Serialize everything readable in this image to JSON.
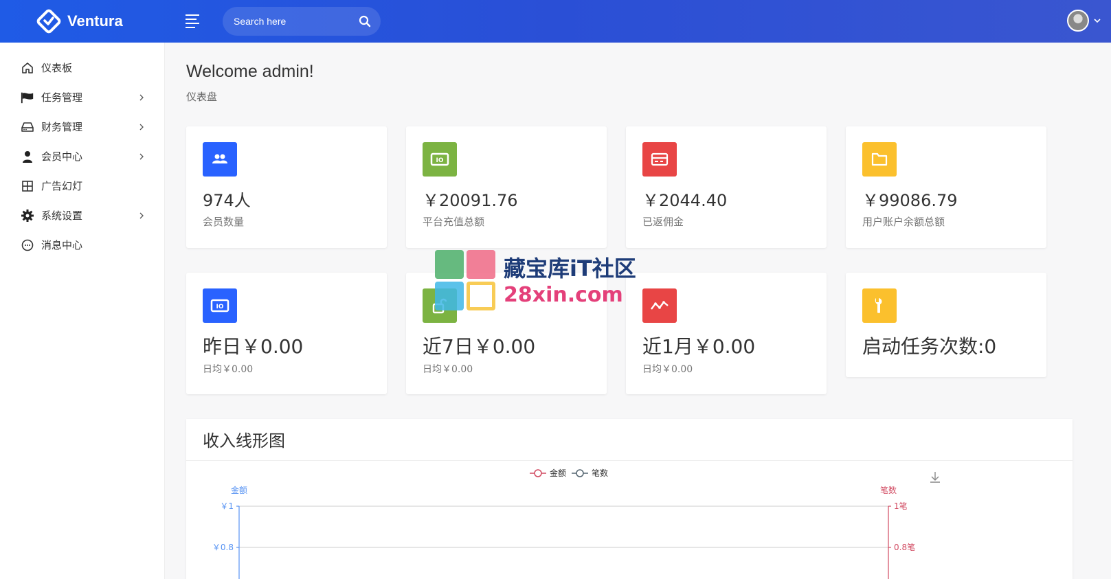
{
  "header": {
    "brand": "Ventura",
    "search_placeholder": "Search here"
  },
  "sidebar": {
    "items": [
      {
        "label": "仪表板",
        "icon": "home-icon",
        "has_children": false
      },
      {
        "label": "任务管理",
        "icon": "flag-icon",
        "has_children": true
      },
      {
        "label": "财务管理",
        "icon": "drive-icon",
        "has_children": true
      },
      {
        "label": "会员中心",
        "icon": "user-icon",
        "has_children": true
      },
      {
        "label": "广告幻灯",
        "icon": "grid-icon",
        "has_children": false
      },
      {
        "label": "系统设置",
        "icon": "gear-icon",
        "has_children": true
      },
      {
        "label": "消息中心",
        "icon": "chat-icon",
        "has_children": false
      }
    ]
  },
  "page": {
    "title": "Welcome admin!",
    "breadcrumb": "仪表盘"
  },
  "stats": [
    {
      "value": "974人",
      "label": "会员数量",
      "color": "#2962ff",
      "icon": "users-icon"
    },
    {
      "value": "￥20091.76",
      "label": "平台充值总额",
      "color": "#7cb342",
      "icon": "money-icon"
    },
    {
      "value": "￥2044.40",
      "label": "已返佣金",
      "color": "#e84545",
      "icon": "card-icon"
    },
    {
      "value": "￥99086.79",
      "label": "用户账户余额总额",
      "color": "#fbc02d",
      "icon": "folder-icon"
    }
  ],
  "periods": [
    {
      "value": "昨日￥0.00",
      "sub": "日均￥0.00",
      "color": "#2962ff",
      "icon": "money-icon"
    },
    {
      "value": "近7日￥0.00",
      "sub": "日均￥0.00",
      "color": "#7cb342",
      "icon": "unlock-icon"
    },
    {
      "value": "近1月￥0.00",
      "sub": "日均￥0.00",
      "color": "#e84545",
      "icon": "trend-icon"
    },
    {
      "value": "启动任务次数:0",
      "sub": "",
      "color": "#fbc02d",
      "icon": "wrench-icon"
    }
  ],
  "chart_data": {
    "type": "line",
    "title": "收入线形图",
    "series": [
      {
        "name": "金额",
        "color": "#d14a61",
        "values": []
      },
      {
        "name": "笔数",
        "color": "#546570",
        "values": []
      }
    ],
    "y_left": {
      "name": "金额",
      "ticks": [
        "￥1",
        "￥0.8"
      ],
      "color": "#5793f3"
    },
    "y_right": {
      "name": "笔数",
      "ticks": [
        "1笔",
        "0.8笔"
      ],
      "color": "#d14a61"
    },
    "legend": "top-center"
  },
  "watermark": {
    "line1": "藏宝库iT社区",
    "line2": "28xin.com"
  }
}
